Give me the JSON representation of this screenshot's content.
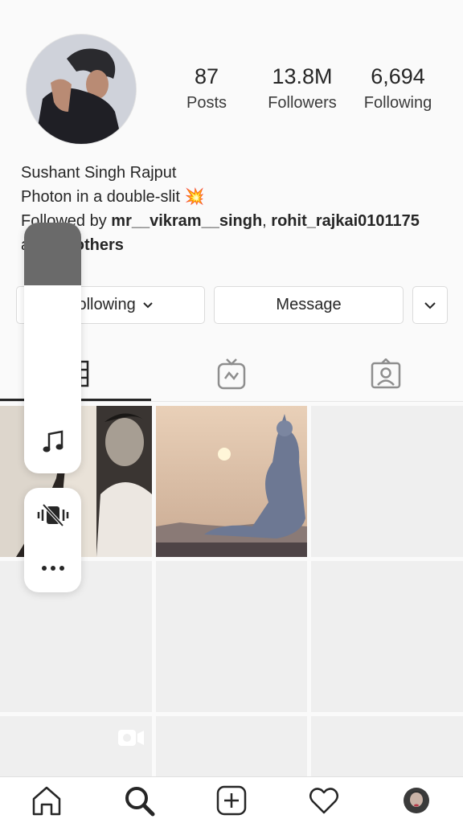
{
  "profile": {
    "stats": [
      {
        "value": "87",
        "label": "Posts"
      },
      {
        "value": "13.8M",
        "label": "Followers"
      },
      {
        "value": "6,694",
        "label": "Following"
      }
    ],
    "name": "Sushant Singh Rajput",
    "bio": "Photon in a double-slit",
    "bio_emoji": "💥",
    "followed_by_prefix": "Followed by ",
    "followed_by_user1": "mr__vikram__singh",
    "followed_by_sep": ", ",
    "followed_by_user2": "rohit_rajkai0101175",
    "followed_by_and": "and ",
    "followed_by_others": "26 others"
  },
  "buttons": {
    "following_label": "Following",
    "message_label": "Message"
  },
  "icons": {
    "tabs": [
      "grid-icon",
      "igtv-icon",
      "tagged-icon"
    ],
    "nav": [
      "home-icon",
      "search-icon",
      "new-post-icon",
      "activity-heart-icon",
      "profile-avatar-icon"
    ],
    "volume": [
      "music-note-icon",
      "vibrate-off-icon",
      "more-icon"
    ]
  },
  "volume_level": 0.25
}
